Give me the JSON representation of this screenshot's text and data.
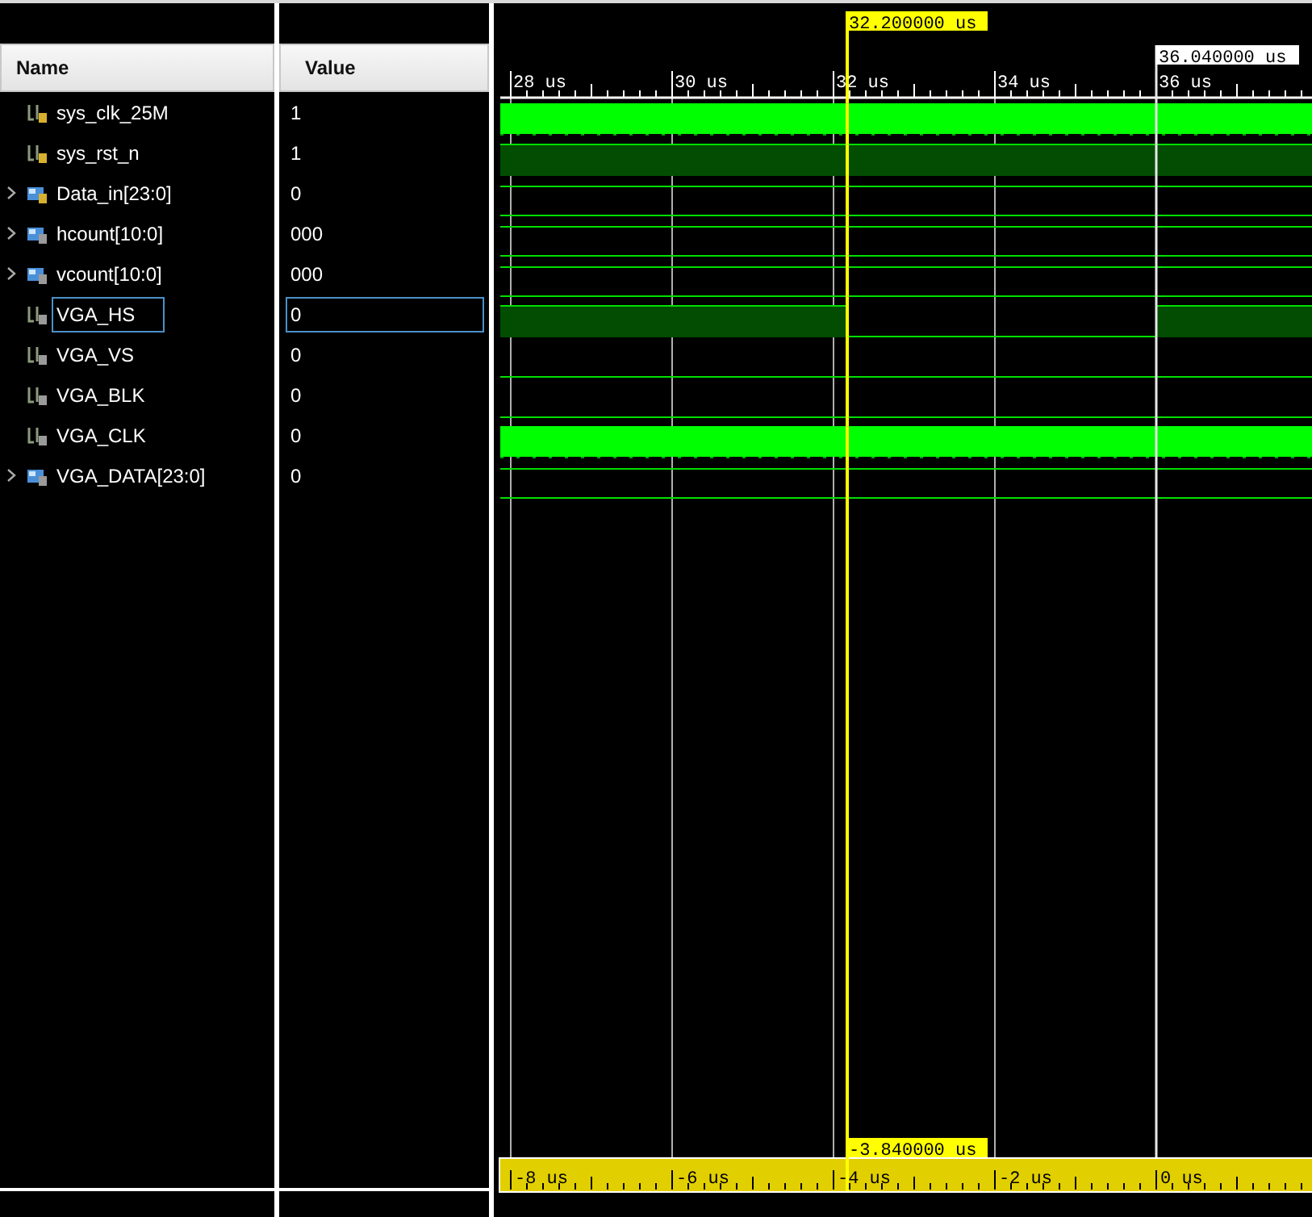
{
  "columns": [
    {
      "label": "Name"
    },
    {
      "label": "Value"
    }
  ],
  "signals": [
    {
      "name": "sys_clk_25M",
      "value": "1",
      "color": "#d8b030",
      "kind": "clock",
      "selected": false
    },
    {
      "name": "sys_rst_n",
      "value": "1",
      "color": "#d8b030",
      "kind": "high",
      "selected": false
    },
    {
      "name": "Data_in[23:0]",
      "value": "0",
      "color": "#d8b030",
      "kind": "bus",
      "expanded": false,
      "selected": false
    },
    {
      "name": "hcount[10:0]",
      "value": "000",
      "color": "#9a9a9a",
      "kind": "bus",
      "expanded": false,
      "selected": false
    },
    {
      "name": "vcount[10:0]",
      "value": "000",
      "color": "#9a9a9a",
      "kind": "bus",
      "expanded": false,
      "selected": false
    },
    {
      "name": "VGA_HS",
      "value": "0",
      "color": "#9a9a9a",
      "kind": "pulse",
      "selected": true
    },
    {
      "name": "VGA_VS",
      "value": "0",
      "color": "#9a9a9a",
      "kind": "low",
      "selected": false
    },
    {
      "name": "VGA_BLK",
      "value": "0",
      "color": "#9a9a9a",
      "kind": "low",
      "selected": false
    },
    {
      "name": "VGA_CLK",
      "value": "0",
      "color": "#9a9a9a",
      "kind": "clock",
      "selected": false
    },
    {
      "name": "VGA_DATA[23:0]",
      "value": "0",
      "color": "#9a9a9a",
      "kind": "bus",
      "expanded": false,
      "selected": false
    }
  ],
  "timeline": {
    "ticks": [
      "28 us",
      "30 us",
      "32 us",
      "34 us",
      "36 us"
    ],
    "cursor_label": "32.200000 us",
    "marker_label": "36.040000 us",
    "delta_label": "-3.840000 us",
    "relative_ticks": [
      "-8 us",
      "-6 us",
      "-4 us",
      "-2 us",
      "0 us"
    ]
  }
}
